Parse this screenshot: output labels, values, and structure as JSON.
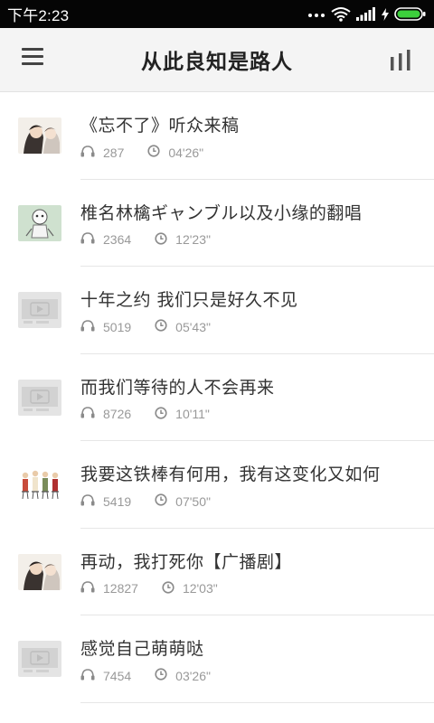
{
  "status_bar": {
    "time": "下午2:23"
  },
  "header": {
    "title": "从此良知是路人",
    "menu_icon": "hamburger-menu-icon",
    "stats_icon": "bar-chart-icon"
  },
  "colors": {
    "status_bar_bg": "#050505",
    "app_bar_bg": "#f4f4f4",
    "title_text": "#222222",
    "meta_text": "#999999",
    "battery_green": "#3ccf3c"
  },
  "items": [
    {
      "title": "《忘不了》听众来稿",
      "plays": "287",
      "duration": "04'26\"",
      "thumb": "couple-portrait"
    },
    {
      "title": "椎名林檎ギャンブル以及小缘的翻唱",
      "plays": "2364",
      "duration": "12'23\"",
      "thumb": "character-art"
    },
    {
      "title": "十年之约  我们只是好久不见",
      "plays": "5019",
      "duration": "05'43\"",
      "thumb": "video-placeholder"
    },
    {
      "title": "而我们等待的人不会再来",
      "plays": "8726",
      "duration": "10'11\"",
      "thumb": "video-placeholder"
    },
    {
      "title": "我要这铁棒有何用，我有这变化又如何",
      "plays": "5419",
      "duration": "07'50\"",
      "thumb": "group-figures"
    },
    {
      "title": "再动，我打死你【广播剧】",
      "plays": "12827",
      "duration": "12'03\"",
      "thumb": "couple-portrait"
    },
    {
      "title": "感觉自己萌萌哒",
      "plays": "7454",
      "duration": "03'26\"",
      "thumb": "video-placeholder"
    }
  ]
}
